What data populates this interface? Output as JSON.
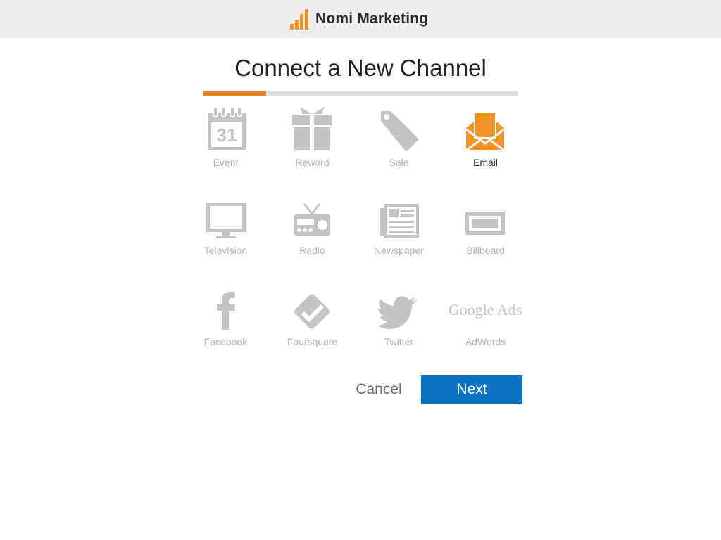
{
  "header": {
    "brand_name": "Nomi Marketing",
    "logo_icon": "bar-chart-logo",
    "accent_color": "#f0922a"
  },
  "dialog": {
    "title": "Connect a New Channel",
    "progress": 0.2
  },
  "channels": [
    {
      "label": "Event",
      "icon": "calendar-icon",
      "selected": false
    },
    {
      "label": "Reward",
      "icon": "gift-icon",
      "selected": false
    },
    {
      "label": "Sale",
      "icon": "tag-icon",
      "selected": false
    },
    {
      "label": "Email",
      "icon": "envelope-icon",
      "selected": true
    },
    {
      "label": "Television",
      "icon": "monitor-icon",
      "selected": false
    },
    {
      "label": "Radio",
      "icon": "radio-icon",
      "selected": false
    },
    {
      "label": "Newspaper",
      "icon": "newspaper-icon",
      "selected": false
    },
    {
      "label": "Billboard",
      "icon": "billboard-icon",
      "selected": false
    },
    {
      "label": "Facebook",
      "icon": "facebook-icon",
      "selected": false
    },
    {
      "label": "Foursquare",
      "icon": "foursquare-icon",
      "selected": false
    },
    {
      "label": "Twitter",
      "icon": "twitter-icon",
      "selected": false
    },
    {
      "label": "AdWords",
      "icon": "google-ads-icon",
      "selected": false
    }
  ],
  "icon_text": {
    "calendar_day": "31",
    "google_ads_text": "Google Ads"
  },
  "colors": {
    "icon_inactive": "#c4c4c4",
    "icon_selected": "#f39325",
    "primary_button": "#0a72c3"
  },
  "actions": {
    "cancel_label": "Cancel",
    "next_label": "Next"
  }
}
